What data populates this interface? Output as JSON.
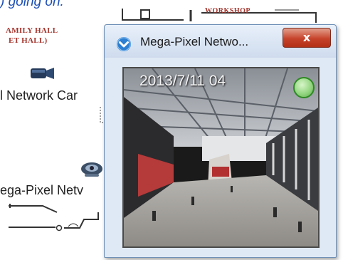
{
  "background": {
    "caption_text": ") going on.",
    "hall_label_lines": [
      "AMILY HALL",
      "ET HALL)"
    ],
    "workshop_label": "WORKSHOP",
    "camera_items": [
      {
        "label": "l Network Car",
        "icon": "camera-icon"
      },
      {
        "label": "ega-Pixel Netv",
        "icon": "ptz-camera-icon"
      }
    ]
  },
  "popup": {
    "title": "Mega-Pixel Netwo...",
    "title_icon": "chevron-down-icon",
    "close_icon": "close-icon",
    "close_glyph": "x",
    "video": {
      "timestamp": "2013/7/11 04",
      "status": "connected",
      "status_color": "#8fd37c"
    }
  }
}
